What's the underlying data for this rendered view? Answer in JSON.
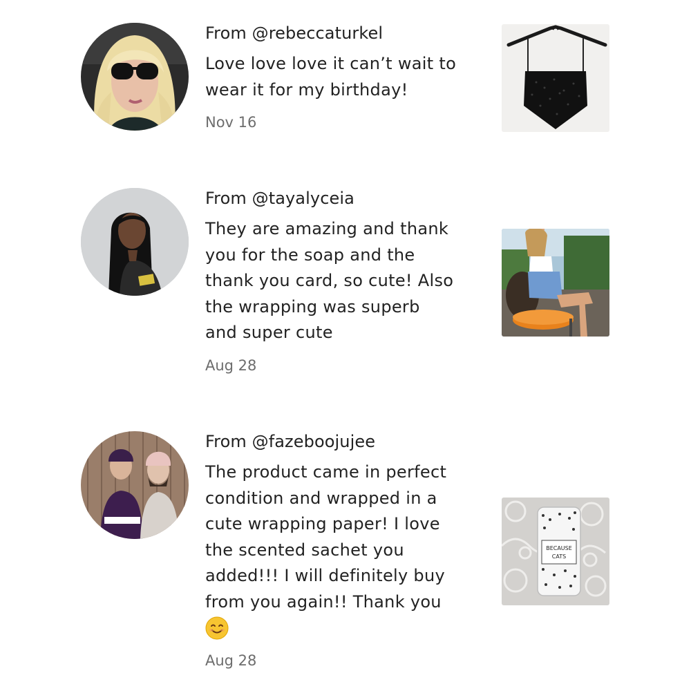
{
  "reviews": [
    {
      "from": "From @rebeccaturkel",
      "body_lines": [
        "Love love love it can’t wait to",
        "wear it for my birthday!"
      ],
      "date": "Nov 16",
      "avatar_icon": "blonde-woman-sunglasses-avatar",
      "thumbnail_icon": "black-camisole-on-hanger-photo"
    },
    {
      "from": "From @tayalyceia",
      "body_lines": [
        "They are amazing and thank",
        "you for the soap and the",
        "thank you card, so cute! Also",
        "the wrapping was superb",
        "and super cute"
      ],
      "date": "Aug 28",
      "avatar_icon": "woman-long-black-hair-avatar",
      "thumbnail_icon": "woman-on-orange-stool-photo"
    },
    {
      "from": "From @fazeboojujee",
      "body_lines": [
        "The product came in perfect",
        "condition and wrapped in a",
        "cute wrapping paper! I love",
        "the scented sachet you",
        "added!!! I will definitely buy",
        "from you again!! Thank you"
      ],
      "date": "Aug 28",
      "avatar_icon": "couple-in-beanies-avatar",
      "thumbnail_icon": "because-cats-phone-case-on-lace-photo",
      "thumbnail_text": [
        "BECAUSE",
        "CATS"
      ],
      "emoji": "smiling-face-emoji"
    }
  ]
}
